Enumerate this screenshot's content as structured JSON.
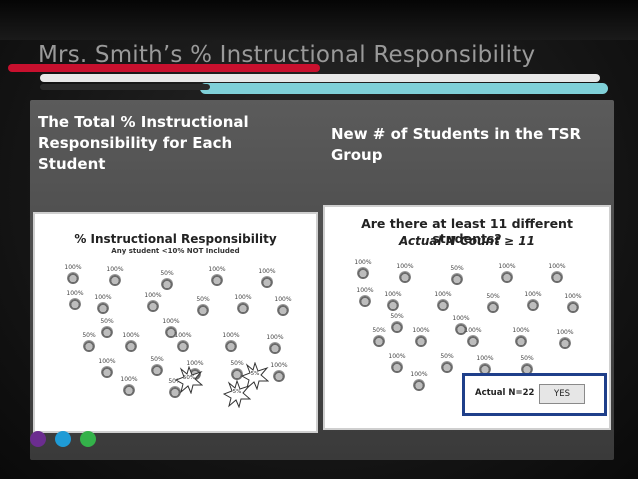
{
  "slide": {
    "title": "Mrs. Smith’s % Instructional Responsibility",
    "left_heading": "The Total % Instructional Responsibility for Each Student",
    "right_heading": "New # of Students in the TSR Group"
  },
  "left_card": {
    "title": "% Instructional Responsibility",
    "subtitle": "Any student <10% NOT Included",
    "students": [
      "100%",
      "100%",
      "50%",
      "100%",
      "100%",
      "100%",
      "100%",
      "100%",
      "50%",
      "100%",
      "100%",
      "50%",
      "100%",
      "50%",
      "100%",
      "100%",
      "100%",
      "100%",
      "100%",
      "50%",
      "100%",
      "50%",
      "100%",
      "100%",
      "50%"
    ],
    "star_students": [
      "50%",
      "5%",
      "5%"
    ]
  },
  "right_card": {
    "title": "Are there at least 11 different students?",
    "subtitle": "Actual N Count ≥ 11",
    "students": [
      "100%",
      "100%",
      "50%",
      "100%",
      "100%",
      "100%",
      "100%",
      "100%",
      "50%",
      "100%",
      "100%",
      "50%",
      "100%",
      "50%",
      "100%",
      "100%",
      "100%",
      "100%",
      "100%",
      "50%",
      "100%",
      "50%",
      "100%"
    ],
    "actual_label": "Actual N=22",
    "yes_label": "YES"
  },
  "colors": {
    "accent_red": "#c8102e",
    "accent_teal": "#7fd0d8",
    "frame_blue": "#1f3f8a",
    "dot_purple": "#6b2d8f",
    "dot_blue": "#1f9bd6",
    "dot_green": "#34b24a"
  }
}
